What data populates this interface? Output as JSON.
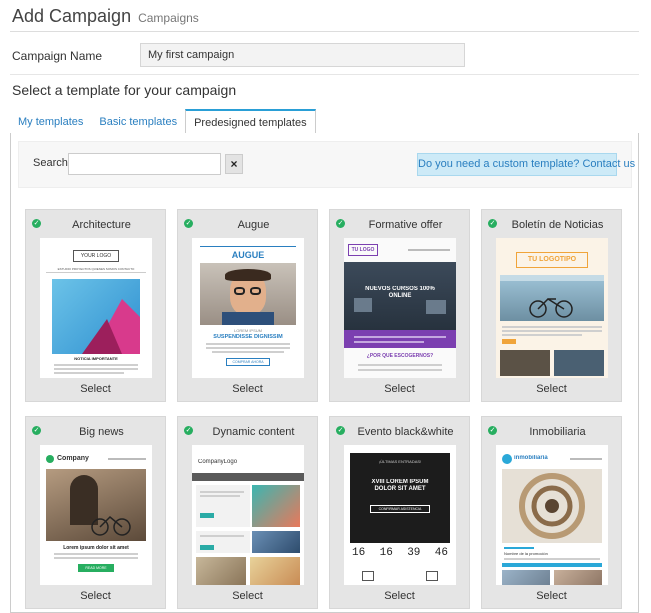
{
  "header": {
    "title": "Add Campaign",
    "subtitle": "Campaigns"
  },
  "form": {
    "name_label": "Campaign Name",
    "name_value": "My first campaign"
  },
  "section_heading": "Select a template for your campaign",
  "tabs": [
    {
      "label": "My templates",
      "active": false
    },
    {
      "label": "Basic templates",
      "active": false
    },
    {
      "label": "Predesigned templates",
      "active": true
    }
  ],
  "search": {
    "label": "Search",
    "value": "",
    "clear_label": "×",
    "custom_button": "Do you need a custom template? Contact us"
  },
  "colors": {
    "accent_blue": "#2a7fc0",
    "check_green": "#27ae60",
    "tab_top": "#2a9fd6"
  },
  "templates": [
    {
      "title": "Architecture",
      "select_label": "Select",
      "preview": {
        "logo": "YOUR LOGO",
        "nav": "ESTUDIO  PROYECTOS  QUIENES SOMOS  CONTACTO",
        "heading": "NOTICIA IMPORTANTE"
      }
    },
    {
      "title": "Augue",
      "select_label": "Select",
      "preview": {
        "heading": "AUGUE",
        "kicker": "LOREM IPSUM",
        "headline": "SUSPENDISSE DIGNISSIM",
        "button": "COMPRAR AHORA"
      }
    },
    {
      "title": "Formative offer",
      "select_label": "Select",
      "preview": {
        "logo": "TU LOGO",
        "banner": "NUEVOS CURSOS 100% ONLINE",
        "question": "¿POR QUÉ ESCOGERNOS?"
      }
    },
    {
      "title": "Boletín de Noticias",
      "select_label": "Select",
      "preview": {
        "logo": "TU LOGOTIPO"
      }
    },
    {
      "title": "Big news",
      "select_label": "Select",
      "preview": {
        "brand": "Company",
        "headline": "Lorem ipsum dolor sit amet",
        "button": "READ MORE"
      }
    },
    {
      "title": "Dynamic content",
      "select_label": "Select",
      "preview": {
        "logo": "CompanyLogo"
      }
    },
    {
      "title": "Evento black&white",
      "select_label": "Select",
      "preview": {
        "kicker": "¡ÚLTIMAS ENTRADAS!",
        "headline": "XVIII LOREM IPSUM DOLOR SIT AMET",
        "button": "CONFIRMAR ASISTENCIA",
        "countdown": [
          "16",
          "16",
          "39",
          "46"
        ]
      }
    },
    {
      "title": "Inmobiliaria",
      "select_label": "Select",
      "preview": {
        "brand": "inmobiliaria",
        "caption": "Nombre de la promoción"
      }
    }
  ]
}
